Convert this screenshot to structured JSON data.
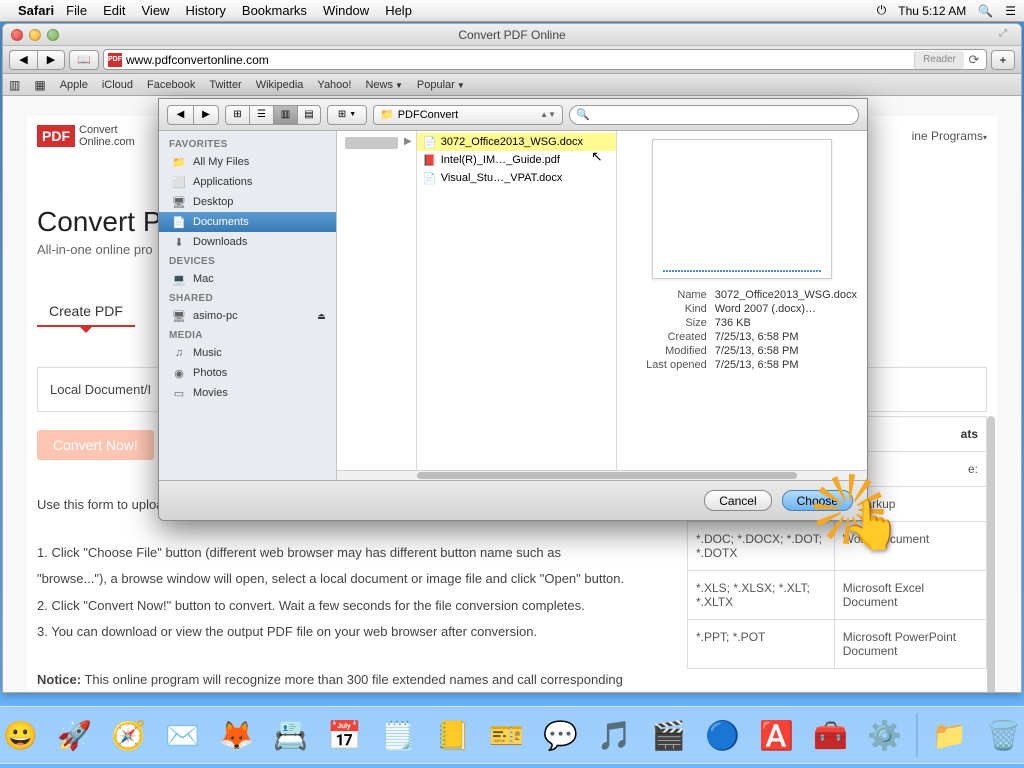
{
  "menubar": {
    "app": "Safari",
    "items": [
      "File",
      "Edit",
      "View",
      "History",
      "Bookmarks",
      "Window",
      "Help"
    ],
    "clock": "Thu 5:12 AM"
  },
  "window": {
    "title": "Convert PDF Online",
    "url": "www.pdfconvertonline.com",
    "reader": "Reader"
  },
  "bookmarks": [
    "Apple",
    "iCloud",
    "Facebook",
    "Twitter",
    "Wikipedia",
    "Yahoo!",
    "News",
    "Popular"
  ],
  "page": {
    "logo_badge": "PDF",
    "logo_line1": "Convert",
    "logo_line2": "Online.com",
    "nav_right": "ine Programs",
    "h1": "Convert PD",
    "sub": "All-in-one online pro",
    "tab_create": "Create PDF",
    "upload_label": "Local Document/I",
    "convert_btn": "Convert Now!",
    "intro": "Use this form to upload a local document or image file and convert it to PDF file.",
    "step1": "1. Click \"Choose File\" button (different web browser may has different button name such as",
    "step1b": "\"browse...\"), a browse window will open, select a local document or image file and click \"Open\" button.",
    "step2": "2. Click \"Convert Now!\" button to convert. Wait a few seconds for the file conversion completes.",
    "step3": "3. You can download or view the output PDF file on your web browser after conversion.",
    "notice_label": "Notice:",
    "notice": " This online program will recognize more than 300 file extended names and call corresponding"
  },
  "formats": {
    "header_right": "ats",
    "col2_row0": "e:",
    "rows": [
      {
        "ext": "",
        "desc": "xt Markup"
      },
      {
        "ext": "*.DOC; *.DOCX; *.DOT; *.DOTX",
        "desc": "Word Document"
      },
      {
        "ext": "*.XLS; *.XLSX; *.XLT; *.XLTX",
        "desc": "Microsoft Excel Document"
      },
      {
        "ext": "*.PPT; *.POT",
        "desc": "Microsoft PowerPoint Document"
      }
    ]
  },
  "dialog": {
    "path_label": "PDFConvert",
    "search_placeholder": "",
    "sidebar": {
      "favorites": "FAVORITES",
      "items_fav": [
        {
          "icon": "📁",
          "label": "All My Files"
        },
        {
          "icon": "⬜",
          "label": "Applications"
        },
        {
          "icon": "🖥",
          "label": "Desktop"
        },
        {
          "icon": "📄",
          "label": "Documents"
        },
        {
          "icon": "⬇",
          "label": "Downloads"
        }
      ],
      "devices": "DEVICES",
      "items_dev": [
        {
          "icon": "💻",
          "label": "Mac"
        }
      ],
      "shared": "SHARED",
      "items_shared": [
        {
          "icon": "🖥",
          "label": "asimo-pc",
          "eject": "⏏"
        }
      ],
      "media": "MEDIA",
      "items_media": [
        {
          "icon": "♫",
          "label": "Music"
        },
        {
          "icon": "◉",
          "label": "Photos"
        },
        {
          "icon": "▭",
          "label": "Movies"
        }
      ]
    },
    "files": [
      {
        "icon": "doc",
        "name": "3072_Office2013_WSG.docx",
        "selected": true
      },
      {
        "icon": "pdf",
        "name": "Intel(R)_IM…_Guide.pdf"
      },
      {
        "icon": "doc",
        "name": "Visual_Stu…_VPAT.docx"
      }
    ],
    "preview": {
      "Name": "3072_Office2013_WSG.docx",
      "Kind": "Word 2007 (.docx)…",
      "Size": "736 KB",
      "Created": "7/25/13, 6:58 PM",
      "Modified": "7/25/13, 6:58 PM",
      "Last opened": "7/25/13, 6:58 PM"
    },
    "cancel": "Cancel",
    "choose": "Choose"
  },
  "dock_icons": [
    "😀",
    "🚀",
    "🧭",
    "✉️",
    "🦊",
    "📇",
    "📅",
    "🗒️",
    "📒",
    "🎫",
    "💬",
    "🎵",
    "🎬",
    "🔵",
    "🅰️",
    "🧰",
    "⚙️",
    "",
    "📁",
    "🗑️"
  ]
}
